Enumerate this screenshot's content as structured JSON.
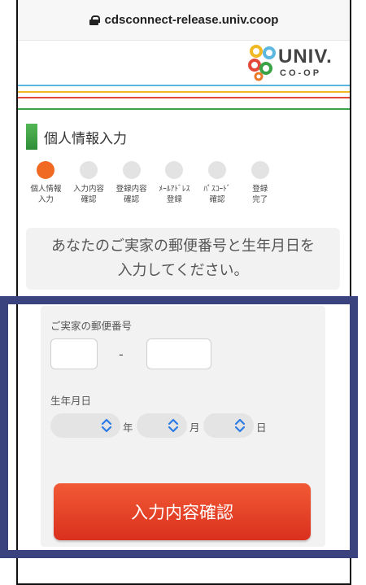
{
  "browser": {
    "url": "cdsconnect-release.univ.coop"
  },
  "logo": {
    "line1": "UNIV.",
    "line2": "CO-OP"
  },
  "section": {
    "title": "個人情報入力"
  },
  "steps": [
    {
      "label": "個人情報\n入力",
      "active": true
    },
    {
      "label": "入力内容\n確認",
      "active": false
    },
    {
      "label": "登録内容\n確認",
      "active": false
    },
    {
      "label": "ﾒｰﾙｱﾄﾞﾚｽ\n登録",
      "active": false
    },
    {
      "label": "ﾊﾟｽｺｰﾄﾞ\n確認",
      "active": false
    },
    {
      "label": "登録\n完了",
      "active": false
    }
  ],
  "notice": {
    "text": "あなたのご実家の郵便番号と生年月日を\n入力してください。"
  },
  "form": {
    "postal_label": "ご実家の郵便番号",
    "postal_first": "",
    "postal_separator": "-",
    "postal_second": "",
    "birth_label": "生年月日",
    "year_value": "",
    "year_unit": "年",
    "month_value": "",
    "month_unit": "月",
    "day_value": "",
    "day_unit": "日",
    "submit_label": "入力内容確認"
  },
  "colors": {
    "accent_green": "#46a548",
    "active_step": "#f06a23",
    "button_red": "#e2401f",
    "highlight_frame": "#3a437d",
    "stripe_blue": "#5bb7e0",
    "stripe_yellow": "#f1b825",
    "stripe_red": "#e2493a",
    "stripe_green": "#3aa346"
  }
}
